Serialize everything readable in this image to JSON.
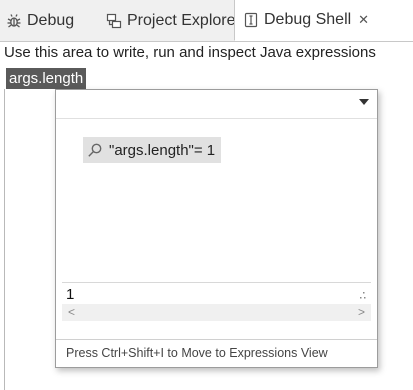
{
  "tabs": [
    {
      "label": "Debug",
      "icon": "debug-bug-icon"
    },
    {
      "label": "Project Explorer",
      "icon": "project-explorer-icon"
    },
    {
      "label": "Debug Shell",
      "icon": "debug-shell-icon",
      "close": "✕"
    }
  ],
  "editor": {
    "info_text": "Use this area to write, run and inspect Java expressions",
    "selected_expression": "args.length"
  },
  "inspect_popup": {
    "result_row": "\"args.length\"= 1",
    "result_icon": "magnifier-icon",
    "details_value": "1",
    "scroll_left": "<",
    "scroll_right": ">",
    "footer_hint": "Press Ctrl+Shift+I to Move to Expressions View"
  }
}
